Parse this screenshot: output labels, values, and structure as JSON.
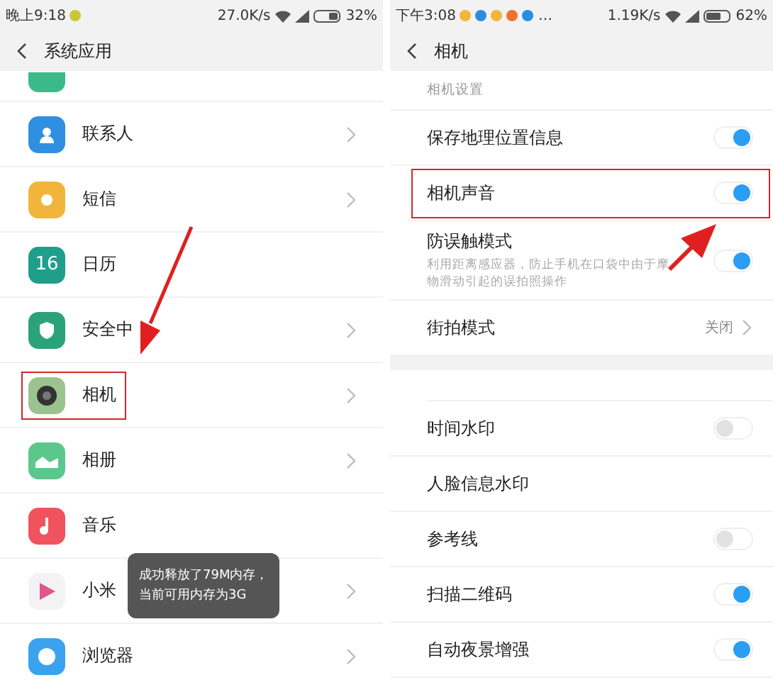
{
  "left": {
    "status": {
      "time": "晚上9:18",
      "speed": "27.0K/s",
      "battery": "32%"
    },
    "header": {
      "title": "系统应用"
    },
    "items": [
      {
        "label": "联系人",
        "chevron": true,
        "highlighted": false
      },
      {
        "label": "短信",
        "chevron": true,
        "highlighted": false
      },
      {
        "label": "日历",
        "icon_text": "16",
        "chevron": false,
        "highlighted": false
      },
      {
        "label": "安全中",
        "chevron": true,
        "highlighted": false
      },
      {
        "label": "相机",
        "chevron": true,
        "highlighted": true
      },
      {
        "label": "相册",
        "chevron": true,
        "highlighted": false
      },
      {
        "label": "音乐",
        "chevron": false,
        "highlighted": false
      },
      {
        "label": "小米",
        "chevron": true,
        "highlighted": false
      },
      {
        "label": "浏览器",
        "chevron": true,
        "highlighted": false
      }
    ],
    "toast": [
      "成功释放了79M内存，",
      "当前可用内存为3G"
    ]
  },
  "right": {
    "status": {
      "time": "下午3:08",
      "more": "…",
      "speed": "1.19K/s",
      "battery": "62%"
    },
    "header": {
      "title": "相机"
    },
    "groups": [
      {
        "label": "相机设置",
        "rows": [
          {
            "kind": "toggle",
            "label": "保存地理位置信息",
            "on": true,
            "highlighted": false
          },
          {
            "kind": "toggle",
            "label": "相机声音",
            "on": true,
            "highlighted": true
          },
          {
            "kind": "toggle",
            "label": "防误触模式",
            "description": [
              "利用距离感应器，防止手机在口袋中由于摩",
              "物滑动引起的误拍照操作"
            ],
            "on": true,
            "highlighted": false
          },
          {
            "kind": "value",
            "label": "街拍模式",
            "value": "关闭",
            "highlighted": false
          }
        ]
      },
      {
        "rows": [
          {
            "kind": "toggle",
            "label": "时间水印",
            "on": false,
            "highlighted": false
          },
          {
            "kind": "plain",
            "label": "人脸信息水印",
            "highlighted": false
          },
          {
            "kind": "toggle",
            "label": "参考线",
            "on": false,
            "highlighted": false
          },
          {
            "kind": "toggle",
            "label": "扫描二维码",
            "on": true,
            "highlighted": false
          },
          {
            "kind": "toggle",
            "label": "自动夜景增强",
            "on": true,
            "highlighted": false
          }
        ]
      }
    ]
  }
}
